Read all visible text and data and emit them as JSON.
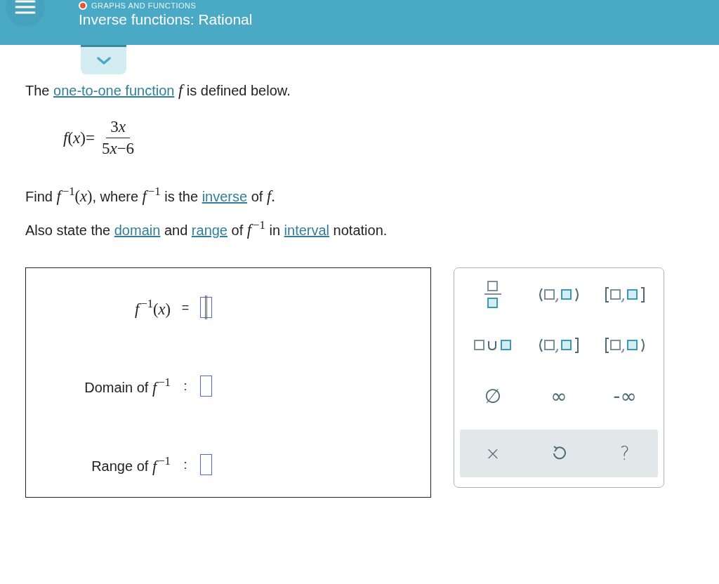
{
  "header": {
    "category": "GRAPHS AND FUNCTIONS",
    "title": "Inverse functions: Rational"
  },
  "problem": {
    "intro": [
      {
        "kind": "text",
        "text": "The "
      },
      {
        "kind": "link",
        "text": "one-to-one function"
      },
      {
        "kind": "math",
        "text": " *f* "
      },
      {
        "kind": "text",
        "text": "is defined below."
      }
    ],
    "formula": {
      "lhs": "*f*(*x*)=",
      "numerator": [
        {
          "kind": "number",
          "text": "3"
        },
        {
          "kind": "variable",
          "text": "x"
        }
      ],
      "denominator": [
        {
          "kind": "number",
          "text": "5"
        },
        {
          "kind": "variable",
          "text": "x"
        },
        {
          "kind": "number",
          "text": "−6"
        }
      ]
    },
    "sentences": [
      [
        {
          "kind": "text",
          "text": "Find "
        },
        {
          "kind": "math",
          "text": "*f*$^{−1}$(*x*)"
        },
        {
          "kind": "text",
          "text": ", where "
        },
        {
          "kind": "math",
          "text": "*f*$^{−1}$"
        },
        {
          "kind": "text",
          "text": " is the "
        },
        {
          "kind": "link",
          "text": "inverse"
        },
        {
          "kind": "text",
          "text": " of "
        },
        {
          "kind": "math",
          "text": "*f*."
        }
      ],
      [
        {
          "kind": "text",
          "text": "Also state the "
        },
        {
          "kind": "link",
          "text": "domain"
        },
        {
          "kind": "text",
          "text": " and "
        },
        {
          "kind": "link",
          "text": "range"
        },
        {
          "kind": "text",
          "text": " of "
        },
        {
          "kind": "math",
          "text": "*f*$^{−1}$"
        },
        {
          "kind": "text",
          "text": " in "
        },
        {
          "kind": "link",
          "text": "interval"
        },
        {
          "kind": "text",
          "text": " notation."
        }
      ]
    ]
  },
  "answers": [
    {
      "label": [
        {
          "kind": "math",
          "text": "*f*$^{−1}$(*x*)"
        }
      ],
      "separator": "=",
      "focused": true
    },
    {
      "label": [
        {
          "kind": "text",
          "text": "Domain of "
        },
        {
          "kind": "math",
          "text": "*f*$^{−1}$"
        }
      ],
      "separator": ":",
      "focused": false
    },
    {
      "label": [
        {
          "kind": "text",
          "text": "Range of "
        },
        {
          "kind": "math",
          "text": "*f*$^{−1}$"
        }
      ],
      "separator": ":",
      "focused": false
    }
  ],
  "keypad": {
    "keys": [
      {
        "kind": "fraction"
      },
      {
        "kind": "open-interval"
      },
      {
        "kind": "closed-interval"
      },
      {
        "kind": "union"
      },
      {
        "kind": "left-open-interval"
      },
      {
        "kind": "right-open-interval"
      },
      {
        "kind": "symbol",
        "label": "∅"
      },
      {
        "kind": "symbol",
        "label": "∞"
      },
      {
        "kind": "symbol",
        "label": "-∞"
      }
    ],
    "actions": [
      {
        "kind": "clear",
        "label": "×"
      },
      {
        "kind": "undo"
      },
      {
        "kind": "help",
        "label": "?"
      }
    ]
  }
}
